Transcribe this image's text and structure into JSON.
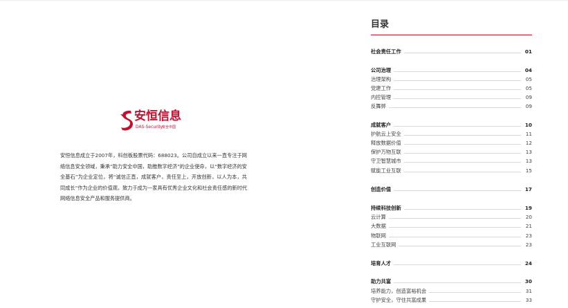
{
  "left_page": {
    "logo": {
      "brand_cn": "安恒信息",
      "brand_en": "DAS-Security",
      "brand_tag": "安全中国",
      "icon": "stylized-s-logo-mark",
      "color": "#c8102e"
    },
    "intro": "安恒信息成立于2007年，科创板股票代码：688023。公司自成立以来一直专注于网络信息安全领域，秉承“助力安全中国，助推数字经济”的企业使命，以“数字经济的安全基石”为企业定位，将“诚信正直，成就客户，责任至上，开放创新，以人为本，共同成长”作为企业的价值观，致力于成为一家具有优秀企业文化和社会责任感的新时代网络信息安全产品和服务提供商。"
  },
  "toc": {
    "title": "目录",
    "accent_color": "#c8102e",
    "entries": [
      {
        "label": "社会责任工作",
        "page": "01",
        "level": "section"
      },
      {
        "label": "公司治理",
        "page": "04",
        "level": "section"
      },
      {
        "label": "治理架构",
        "page": "05",
        "level": "sub"
      },
      {
        "label": "党建工作",
        "page": "05",
        "level": "sub"
      },
      {
        "label": "内控管理",
        "page": "09",
        "level": "sub"
      },
      {
        "label": "反舞弊",
        "page": "09",
        "level": "sub"
      },
      {
        "label": "成就客户",
        "page": "10",
        "level": "section"
      },
      {
        "label": "护航云上安全",
        "page": "11",
        "level": "sub"
      },
      {
        "label": "释放数据价值",
        "page": "12",
        "level": "sub"
      },
      {
        "label": "保护万物互联",
        "page": "13",
        "level": "sub"
      },
      {
        "label": "守卫智慧城市",
        "page": "13",
        "level": "sub"
      },
      {
        "label": "赋能工业互联",
        "page": "15",
        "level": "sub"
      },
      {
        "label": "创造价值",
        "page": "17",
        "level": "section"
      },
      {
        "label": "持续科技创新",
        "page": "19",
        "level": "section"
      },
      {
        "label": "云计算",
        "page": "20",
        "level": "sub"
      },
      {
        "label": "大数据",
        "page": "21",
        "level": "sub"
      },
      {
        "label": "物联网",
        "page": "23",
        "level": "sub"
      },
      {
        "label": "工业互联网",
        "page": "23",
        "level": "sub"
      },
      {
        "label": "培育人才",
        "page": "24",
        "level": "section"
      },
      {
        "label": "助力共富",
        "page": "30",
        "level": "section"
      },
      {
        "label": "培养能力，创造富裕机会",
        "page": "31",
        "level": "sub"
      },
      {
        "label": "守护安全，守住共富成果",
        "page": "33",
        "level": "sub"
      }
    ]
  }
}
